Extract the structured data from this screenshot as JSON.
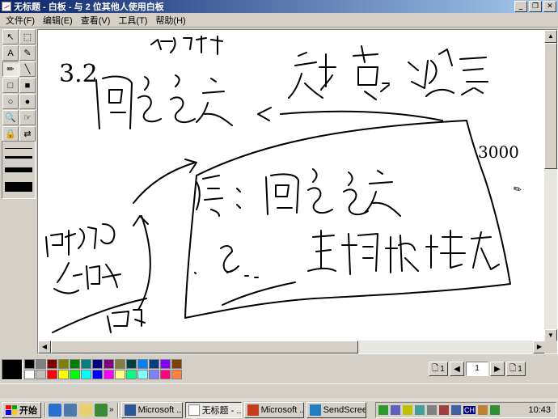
{
  "window": {
    "title": "无标题 - 白板 - 与 2 位其他人使用白板",
    "controls": [
      "_",
      "❐",
      "✕"
    ]
  },
  "menu": [
    "文件(F)",
    "编辑(E)",
    "查看(V)",
    "工具(T)",
    "帮助(H)"
  ],
  "tools": [
    {
      "name": "select-tool-icon",
      "glyph": "↖"
    },
    {
      "name": "zoom-select-tool-icon",
      "glyph": "⬚"
    },
    {
      "name": "text-tool-icon",
      "glyph": "A"
    },
    {
      "name": "highlighter-tool-icon",
      "glyph": "✎"
    },
    {
      "name": "pen-tool-icon",
      "glyph": "✏"
    },
    {
      "name": "line-tool-icon",
      "glyph": "╲"
    },
    {
      "name": "rectangle-tool-icon",
      "glyph": "□"
    },
    {
      "name": "filled-rectangle-tool-icon",
      "glyph": "■"
    },
    {
      "name": "ellipse-tool-icon",
      "glyph": "○"
    },
    {
      "name": "filled-ellipse-tool-icon",
      "glyph": "●"
    },
    {
      "name": "zoom-tool-icon",
      "glyph": "🔍"
    },
    {
      "name": "remote-pointer-tool-icon",
      "glyph": "☞"
    },
    {
      "name": "lock-contents-tool-icon",
      "glyph": "🔒"
    },
    {
      "name": "synchronize-tool-icon",
      "glyph": "⇄"
    },
    {
      "name": "select-area-tool-icon",
      "glyph": "▭"
    },
    {
      "name": "select-window-tool-icon",
      "glyph": "▣"
    }
  ],
  "palette_colors": [
    "#000000",
    "#808080",
    "#800000",
    "#808000",
    "#008000",
    "#008080",
    "#000080",
    "#800080",
    "#808040",
    "#004040",
    "#0080ff",
    "#004080",
    "#8000ff",
    "#804000",
    "#ffffff",
    "#c0c0c0",
    "#ff0000",
    "#ffff00",
    "#00ff00",
    "#00ffff",
    "#0000ff",
    "#ff00ff",
    "#ffff80",
    "#00ff80",
    "#80ffff",
    "#8080ff",
    "#ff0080",
    "#ff8040"
  ],
  "current_color": "#000000",
  "page": {
    "insert_before_label": "1",
    "current_page": "1",
    "insert_after_label": "1"
  },
  "taskbar": {
    "start_label": "开始",
    "tasks": [
      {
        "label": "Microsoft ...",
        "active": false
      },
      {
        "label": "无标题 - ...",
        "active": true
      },
      {
        "label": "Microsoft ...",
        "active": false
      },
      {
        "label": "SendScreen",
        "active": false
      }
    ],
    "tray_ch": "CH",
    "clock": "10:43"
  },
  "whiteboard_text": {
    "note_3_2": "3.2",
    "note_3000": "3000"
  }
}
